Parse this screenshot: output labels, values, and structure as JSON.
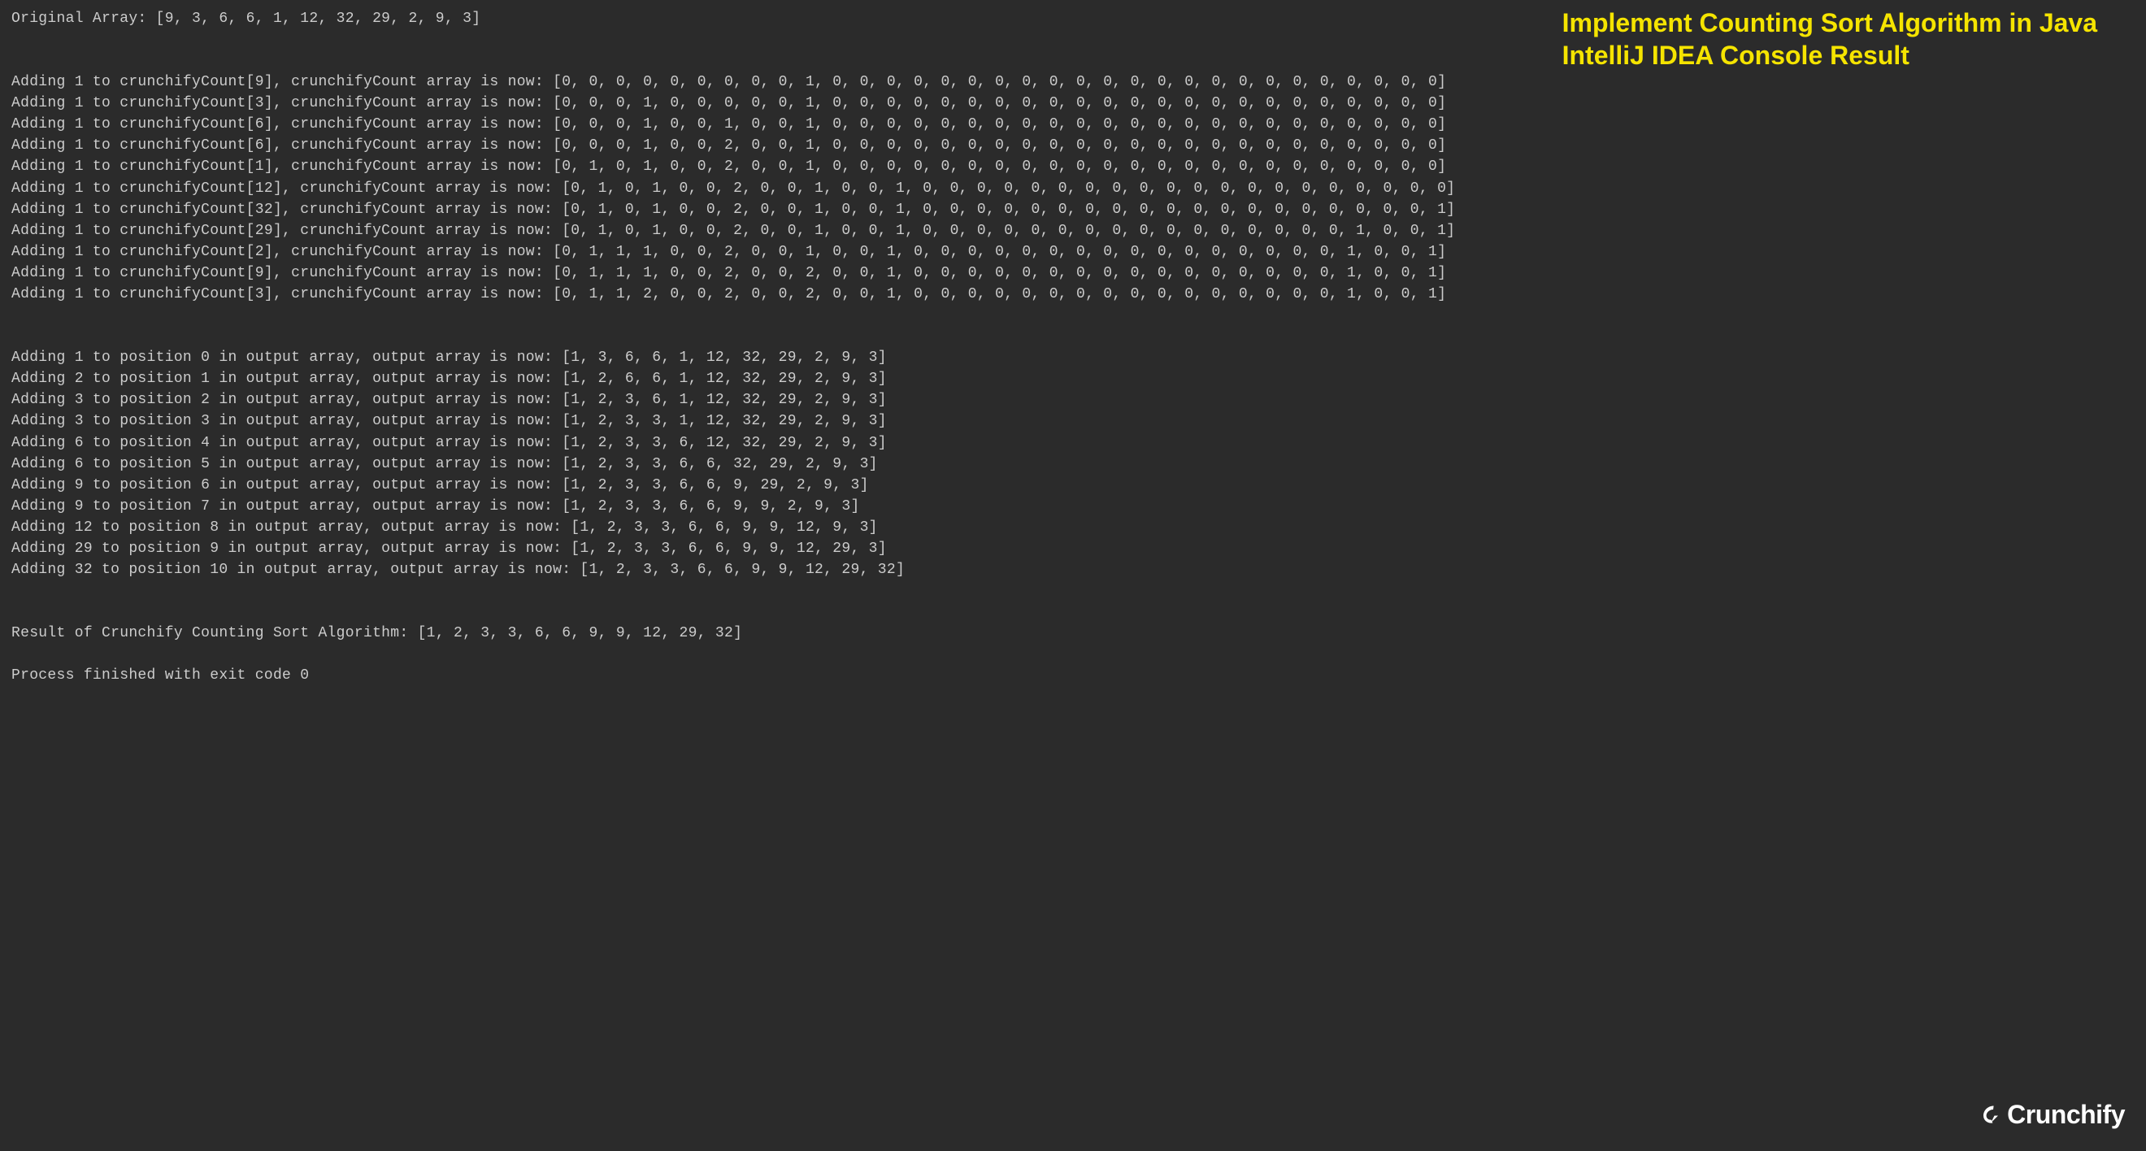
{
  "title_line1": "Implement Counting Sort Algorithm in Java",
  "title_line2": "IntelliJ IDEA Console Result",
  "brand": "Crunchify",
  "console": {
    "original": "Original Array: [9, 3, 6, 6, 1, 12, 32, 29, 2, 9, 3]",
    "count_phase": [
      "Adding 1 to crunchifyCount[9], crunchifyCount array is now: [0, 0, 0, 0, 0, 0, 0, 0, 0, 1, 0, 0, 0, 0, 0, 0, 0, 0, 0, 0, 0, 0, 0, 0, 0, 0, 0, 0, 0, 0, 0, 0, 0]",
      "Adding 1 to crunchifyCount[3], crunchifyCount array is now: [0, 0, 0, 1, 0, 0, 0, 0, 0, 1, 0, 0, 0, 0, 0, 0, 0, 0, 0, 0, 0, 0, 0, 0, 0, 0, 0, 0, 0, 0, 0, 0, 0]",
      "Adding 1 to crunchifyCount[6], crunchifyCount array is now: [0, 0, 0, 1, 0, 0, 1, 0, 0, 1, 0, 0, 0, 0, 0, 0, 0, 0, 0, 0, 0, 0, 0, 0, 0, 0, 0, 0, 0, 0, 0, 0, 0]",
      "Adding 1 to crunchifyCount[6], crunchifyCount array is now: [0, 0, 0, 1, 0, 0, 2, 0, 0, 1, 0, 0, 0, 0, 0, 0, 0, 0, 0, 0, 0, 0, 0, 0, 0, 0, 0, 0, 0, 0, 0, 0, 0]",
      "Adding 1 to crunchifyCount[1], crunchifyCount array is now: [0, 1, 0, 1, 0, 0, 2, 0, 0, 1, 0, 0, 0, 0, 0, 0, 0, 0, 0, 0, 0, 0, 0, 0, 0, 0, 0, 0, 0, 0, 0, 0, 0]",
      "Adding 1 to crunchifyCount[12], crunchifyCount array is now: [0, 1, 0, 1, 0, 0, 2, 0, 0, 1, 0, 0, 1, 0, 0, 0, 0, 0, 0, 0, 0, 0, 0, 0, 0, 0, 0, 0, 0, 0, 0, 0, 0]",
      "Adding 1 to crunchifyCount[32], crunchifyCount array is now: [0, 1, 0, 1, 0, 0, 2, 0, 0, 1, 0, 0, 1, 0, 0, 0, 0, 0, 0, 0, 0, 0, 0, 0, 0, 0, 0, 0, 0, 0, 0, 0, 1]",
      "Adding 1 to crunchifyCount[29], crunchifyCount array is now: [0, 1, 0, 1, 0, 0, 2, 0, 0, 1, 0, 0, 1, 0, 0, 0, 0, 0, 0, 0, 0, 0, 0, 0, 0, 0, 0, 0, 0, 1, 0, 0, 1]",
      "Adding 1 to crunchifyCount[2], crunchifyCount array is now: [0, 1, 1, 1, 0, 0, 2, 0, 0, 1, 0, 0, 1, 0, 0, 0, 0, 0, 0, 0, 0, 0, 0, 0, 0, 0, 0, 0, 0, 1, 0, 0, 1]",
      "Adding 1 to crunchifyCount[9], crunchifyCount array is now: [0, 1, 1, 1, 0, 0, 2, 0, 0, 2, 0, 0, 1, 0, 0, 0, 0, 0, 0, 0, 0, 0, 0, 0, 0, 0, 0, 0, 0, 1, 0, 0, 1]",
      "Adding 1 to crunchifyCount[3], crunchifyCount array is now: [0, 1, 1, 2, 0, 0, 2, 0, 0, 2, 0, 0, 1, 0, 0, 0, 0, 0, 0, 0, 0, 0, 0, 0, 0, 0, 0, 0, 0, 1, 0, 0, 1]"
    ],
    "output_phase": [
      "Adding 1 to position 0 in output array, output array is now: [1, 3, 6, 6, 1, 12, 32, 29, 2, 9, 3]",
      "Adding 2 to position 1 in output array, output array is now: [1, 2, 6, 6, 1, 12, 32, 29, 2, 9, 3]",
      "Adding 3 to position 2 in output array, output array is now: [1, 2, 3, 6, 1, 12, 32, 29, 2, 9, 3]",
      "Adding 3 to position 3 in output array, output array is now: [1, 2, 3, 3, 1, 12, 32, 29, 2, 9, 3]",
      "Adding 6 to position 4 in output array, output array is now: [1, 2, 3, 3, 6, 12, 32, 29, 2, 9, 3]",
      "Adding 6 to position 5 in output array, output array is now: [1, 2, 3, 3, 6, 6, 32, 29, 2, 9, 3]",
      "Adding 9 to position 6 in output array, output array is now: [1, 2, 3, 3, 6, 6, 9, 29, 2, 9, 3]",
      "Adding 9 to position 7 in output array, output array is now: [1, 2, 3, 3, 6, 6, 9, 9, 2, 9, 3]",
      "Adding 12 to position 8 in output array, output array is now: [1, 2, 3, 3, 6, 6, 9, 9, 12, 9, 3]",
      "Adding 29 to position 9 in output array, output array is now: [1, 2, 3, 3, 6, 6, 9, 9, 12, 29, 3]",
      "Adding 32 to position 10 in output array, output array is now: [1, 2, 3, 3, 6, 6, 9, 9, 12, 29, 32]"
    ],
    "result": "Result of Crunchify Counting Sort Algorithm: [1, 2, 3, 3, 6, 6, 9, 9, 12, 29, 32]",
    "process": "Process finished with exit code 0"
  }
}
